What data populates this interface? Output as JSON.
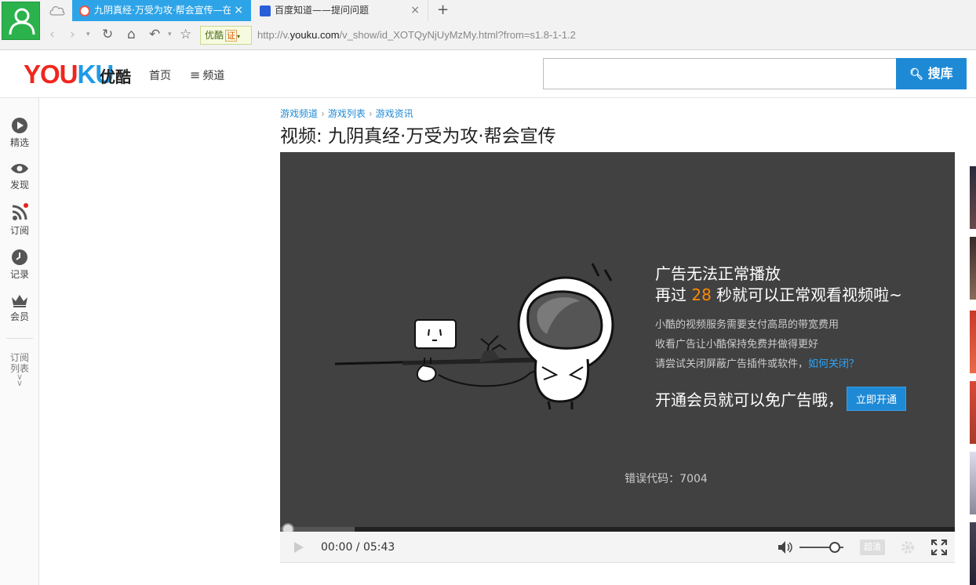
{
  "browser": {
    "tabs": [
      {
        "title": "九阴真经·万受为攻·帮会宣传—在",
        "close": "×"
      },
      {
        "title": "百度知道——提问问题",
        "close": "×"
      }
    ],
    "new_tab": "+",
    "badge_text": "优酷",
    "badge_cert": "证",
    "url_prefix": "http://v.",
    "url_domain": "youku.com",
    "url_path": "/v_show/id_XOTQyNjUyMzMy.html?from=s1.8-1-1.2"
  },
  "header": {
    "logo_you": "YOU",
    "logo_ku": "KU",
    "logo_cn": "优酷",
    "nav_home": "首页",
    "nav_channel": "频道",
    "search_placeholder": "",
    "search_button": "搜库"
  },
  "sidebar": {
    "items": [
      {
        "label": "精选",
        "icon": "play-circle-icon"
      },
      {
        "label": "发现",
        "icon": "eye-icon"
      },
      {
        "label": "订阅",
        "icon": "rss-icon"
      },
      {
        "label": "记录",
        "icon": "clock-icon"
      },
      {
        "label": "会员",
        "icon": "crown-icon"
      }
    ],
    "collapse_line1": "订阅",
    "collapse_line2": "列表"
  },
  "breadcrumb": [
    "游戏频道",
    "游戏列表",
    "游戏资讯"
  ],
  "video_title": "视频: 九阴真经·万受为攻·帮会宣传",
  "player": {
    "ad_line1": "广告无法正常播放",
    "ad_line2_pre": "再过 ",
    "countdown": "28",
    "ad_line2_post": " 秒就可以正常观看视频啦~",
    "info1": "小酷的视频服务需要支付高昂的带宽费用",
    "info2": "收看广告让小酷保持免费并做得更好",
    "info3_pre": "请尝试关闭屏蔽广告插件或软件，",
    "info3_link": "如何关闭？",
    "member_text": "开通会员就可以免广告哦，",
    "open_button": "立即开通",
    "error_code": "错误代码：7004",
    "time_display": "00:00 / 05:43",
    "quality": "超清",
    "volume_level": 0.8
  },
  "colors": {
    "accent_blue": "#1e8ad6",
    "youku_red": "#f0261e",
    "youku_blue": "#1e9be8",
    "countdown_orange": "#ff8a00"
  }
}
